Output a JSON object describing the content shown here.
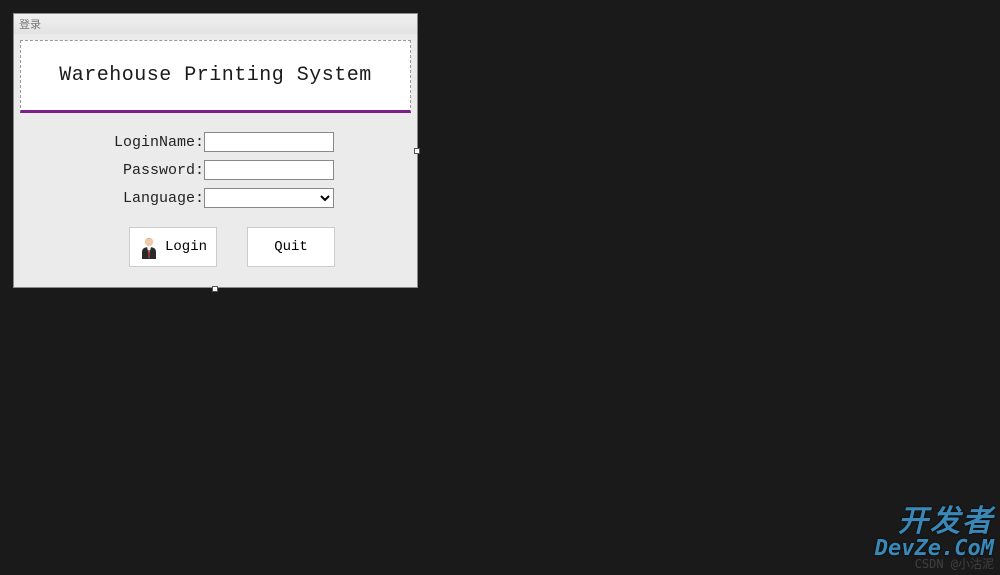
{
  "window": {
    "title": "登录",
    "header": "Warehouse Printing System"
  },
  "form": {
    "loginNameLabel": "LoginName:",
    "loginNameValue": "",
    "passwordLabel": "Password:",
    "passwordValue": "",
    "languageLabel": "Language:",
    "languageValue": ""
  },
  "buttons": {
    "login": "Login",
    "quit": "Quit"
  },
  "watermark": {
    "cn": "开发者",
    "en": "DevZe.CoM",
    "sub": "CSDN @小沽泥"
  }
}
